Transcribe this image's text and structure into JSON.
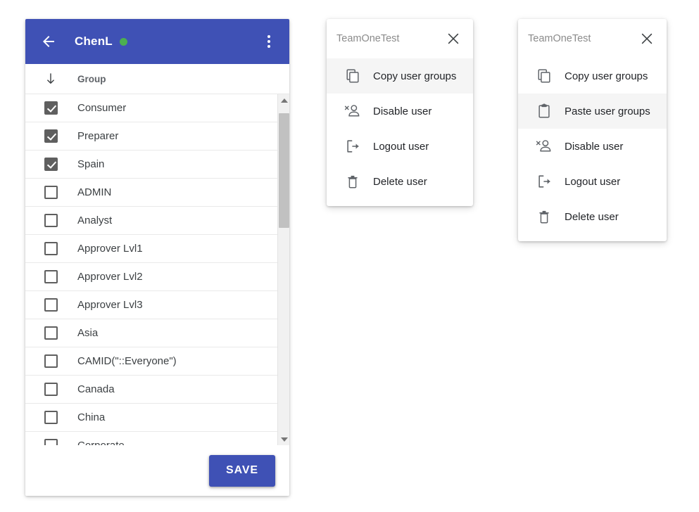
{
  "user_panel": {
    "title": "ChenL",
    "status_color": "#4caf50",
    "back_icon": "arrow-left-icon",
    "overflow_icon": "more-vert-icon",
    "header_color": "#3f51b5",
    "column_header": "Group",
    "sort_icon": "arrow-down-icon",
    "save_label": "SAVE",
    "groups": [
      {
        "label": "Consumer",
        "checked": true
      },
      {
        "label": "Preparer",
        "checked": true
      },
      {
        "label": "Spain",
        "checked": true
      },
      {
        "label": "ADMIN",
        "checked": false
      },
      {
        "label": "Analyst",
        "checked": false
      },
      {
        "label": "Approver Lvl1",
        "checked": false
      },
      {
        "label": "Approver Lvl2",
        "checked": false
      },
      {
        "label": "Approver Lvl3",
        "checked": false
      },
      {
        "label": "Asia",
        "checked": false
      },
      {
        "label": "CAMID(\"::Everyone\")",
        "checked": false
      },
      {
        "label": "Canada",
        "checked": false
      },
      {
        "label": "China",
        "checked": false
      },
      {
        "label": "Corporate",
        "checked": false
      }
    ]
  },
  "menu2": {
    "team": "TeamOneTest",
    "close_icon": "close-icon",
    "items": [
      {
        "label": "Copy user groups",
        "icon": "copy-icon",
        "highlighted": true
      },
      {
        "label": "Disable user",
        "icon": "user-disable-icon",
        "highlighted": false
      },
      {
        "label": "Logout user",
        "icon": "logout-icon",
        "highlighted": false
      },
      {
        "label": "Delete user",
        "icon": "trash-icon",
        "highlighted": false
      }
    ]
  },
  "menu3": {
    "team": "TeamOneTest",
    "close_icon": "close-icon",
    "items": [
      {
        "label": "Copy user groups",
        "icon": "copy-icon",
        "highlighted": false
      },
      {
        "label": "Paste user groups",
        "icon": "clipboard-icon",
        "highlighted": true
      },
      {
        "label": "Disable user",
        "icon": "user-disable-icon",
        "highlighted": false
      },
      {
        "label": "Logout user",
        "icon": "logout-icon",
        "highlighted": false
      },
      {
        "label": "Delete user",
        "icon": "trash-icon",
        "highlighted": false
      }
    ]
  }
}
